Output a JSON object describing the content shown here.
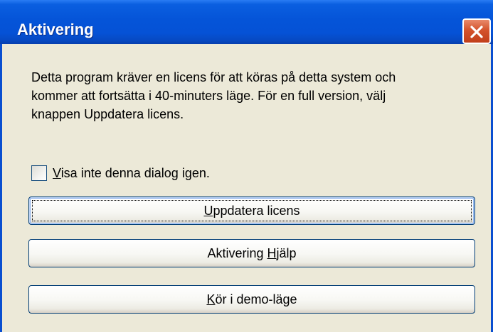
{
  "window": {
    "title": "Aktivering"
  },
  "message": {
    "lines": [
      "Detta program kräver en licens för att köras på detta system och",
      "kommer att fortsätta i 40-minuters läge. För en full version, välj",
      "knappen Uppdatera licens."
    ]
  },
  "checkbox": {
    "label_mnemonic": "V",
    "label_rest": "isa inte denna dialog igen.",
    "checked": false
  },
  "buttons": {
    "update": {
      "mnemonic": "U",
      "rest": "ppdatera licens"
    },
    "help": {
      "before": "Aktivering ",
      "mnemonic": "H",
      "rest": "jälp"
    },
    "demo": {
      "mnemonic": "K",
      "rest": "ör i demo-läge"
    }
  },
  "icons": {
    "close": "close-icon"
  },
  "colors": {
    "titlebar": "#0554d8",
    "window_bg": "#ece9d8",
    "close_button": "#d4532c",
    "button_border": "#003c74"
  }
}
